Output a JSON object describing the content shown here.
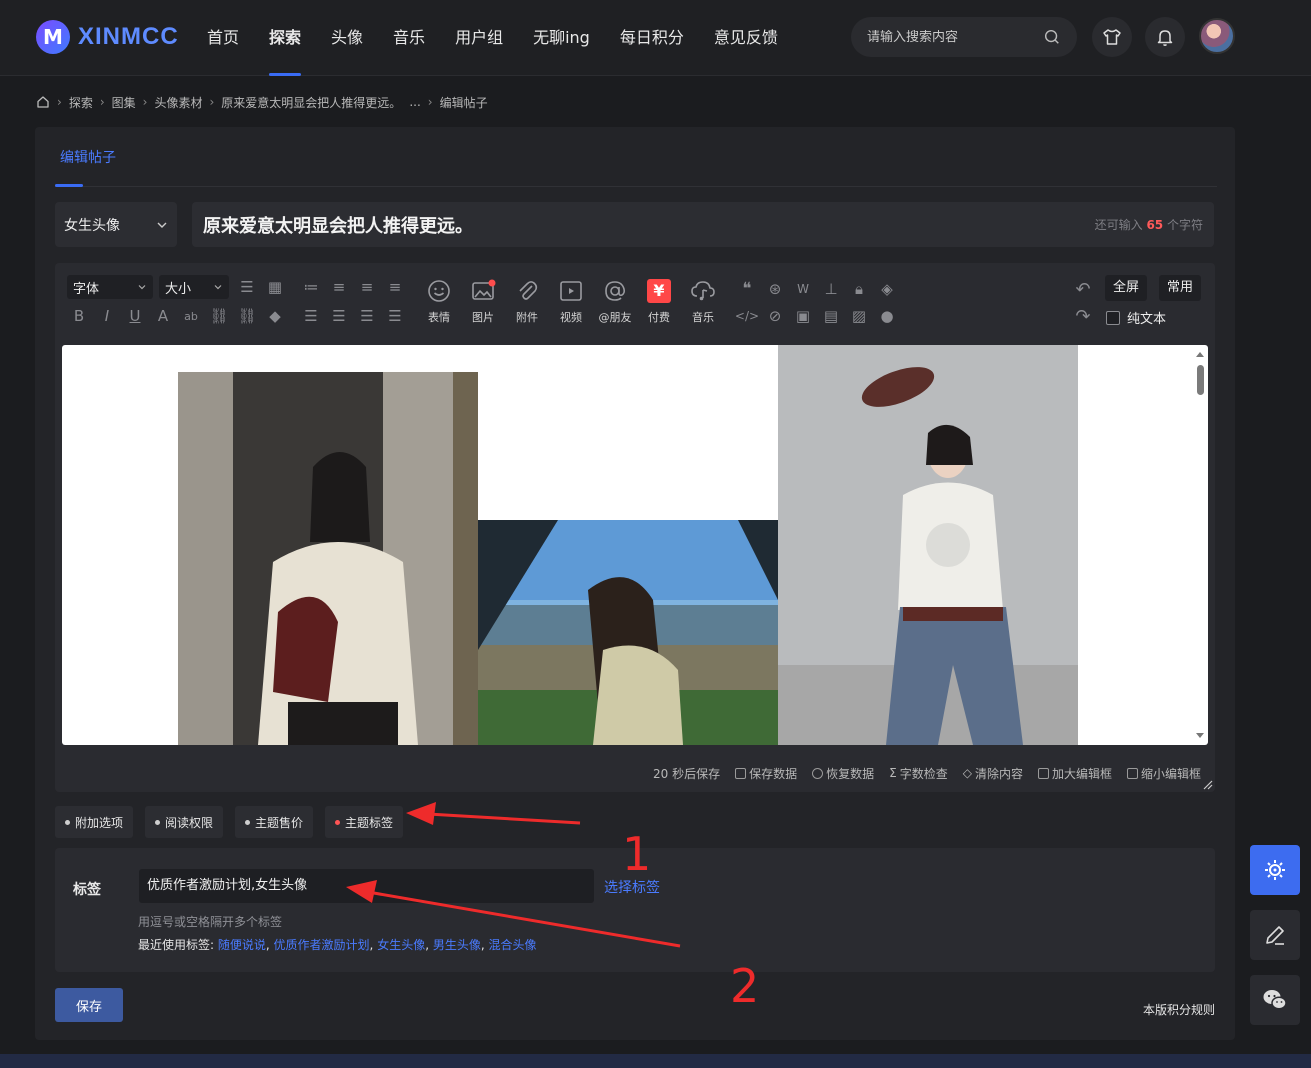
{
  "header": {
    "logo_letter": "M",
    "logo_text": "XINMCC",
    "nav": [
      {
        "label": "首页",
        "active": false
      },
      {
        "label": "探索",
        "active": true
      },
      {
        "label": "头像",
        "active": false
      },
      {
        "label": "音乐",
        "active": false
      },
      {
        "label": "用户组",
        "active": false
      },
      {
        "label": "无聊ing",
        "active": false
      },
      {
        "label": "每日积分",
        "active": false
      },
      {
        "label": "意见反馈",
        "active": false
      }
    ],
    "search_placeholder": "请输入搜索内容"
  },
  "breadcrumb": [
    "探索",
    "图集",
    "头像素材",
    "原来爱意太明显会把人推得更远。",
    "...",
    "编辑帖子"
  ],
  "page": {
    "tab": "编辑帖子",
    "category": "女生头像",
    "title": "原来爱意太明显会把人推得更远。",
    "char_count_prefix": "还可输入",
    "char_count_value": "65",
    "char_count_suffix": "个字符"
  },
  "editor": {
    "font_label": "字体",
    "size_label": "大小",
    "tools": [
      "表情",
      "图片",
      "附件",
      "视频",
      "@朋友",
      "付费",
      "音乐"
    ],
    "fullscreen": "全屏",
    "common": "常用",
    "plain_text": "纯文本",
    "footer": [
      "20 秒后保存",
      "保存数据",
      "恢复数据",
      "字数检查",
      "清除内容",
      "加大编辑框",
      "缩小编辑框"
    ]
  },
  "options": [
    "附加选项",
    "阅读权限",
    "主题售价",
    "主题标签"
  ],
  "tags": {
    "label": "标签",
    "value": "优质作者激励计划,女生头像",
    "choose": "选择标签",
    "hint": "用逗号或空格隔开多个标签",
    "recent_label": "最近使用标签:",
    "recent": [
      "随便说说",
      "优质作者激励计划",
      "女生头像",
      "男生头像",
      "混合头像"
    ]
  },
  "actions": {
    "save": "保存",
    "rules": "本版积分规则"
  },
  "annotations": {
    "num1": "1",
    "num2": "2",
    "color": "#ee2b2b"
  },
  "colors": {
    "accent": "#3a6cf5",
    "background": "#1b1c1f",
    "panel": "#232428"
  }
}
